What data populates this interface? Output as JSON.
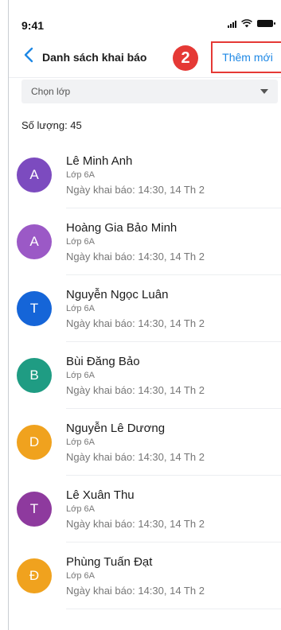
{
  "status_bar": {
    "time": "9:41"
  },
  "nav": {
    "title": "Danh sách khai báo",
    "badge": "2",
    "add_label": "Thêm mới"
  },
  "filter": {
    "placeholder": "Chọn lớp"
  },
  "count_label": "Số lượng: 45",
  "colors": {
    "accent_blue": "#1e88e5",
    "highlight_red": "#e53935"
  },
  "students": [
    {
      "initial": "A",
      "name": "Lê Minh Anh",
      "class": "Lớp 6A",
      "date": "Ngày khai báo: 14:30, 14 Th 2",
      "color": "#7c4bbf"
    },
    {
      "initial": "A",
      "name": "Hoàng Gia Bảo Minh",
      "class": "Lớp 6A",
      "date": "Ngày khai báo: 14:30, 14 Th 2",
      "color": "#9b59c6"
    },
    {
      "initial": "T",
      "name": "Nguyễn Ngọc Luân",
      "class": "Lớp 6A",
      "date": "Ngày khai báo: 14:30, 14 Th 2",
      "color": "#1565d8"
    },
    {
      "initial": "B",
      "name": "Bùi Đăng Bảo",
      "class": "Lớp 6A",
      "date": "Ngày khai báo: 14:30, 14 Th 2",
      "color": "#1f9c83"
    },
    {
      "initial": "D",
      "name": "Nguyễn Lê Dương",
      "class": "Lớp 6A",
      "date": "Ngày khai báo: 14:30, 14 Th 2",
      "color": "#f0a21e"
    },
    {
      "initial": "T",
      "name": "Lê Xuân Thu",
      "class": "Lớp 6A",
      "date": "Ngày khai báo: 14:30, 14 Th 2",
      "color": "#8e3a9e"
    },
    {
      "initial": "Đ",
      "name": "Phùng Tuấn Đạt",
      "class": "Lớp 6A",
      "date": "Ngày khai báo: 14:30, 14 Th 2",
      "color": "#f0a21e"
    }
  ]
}
